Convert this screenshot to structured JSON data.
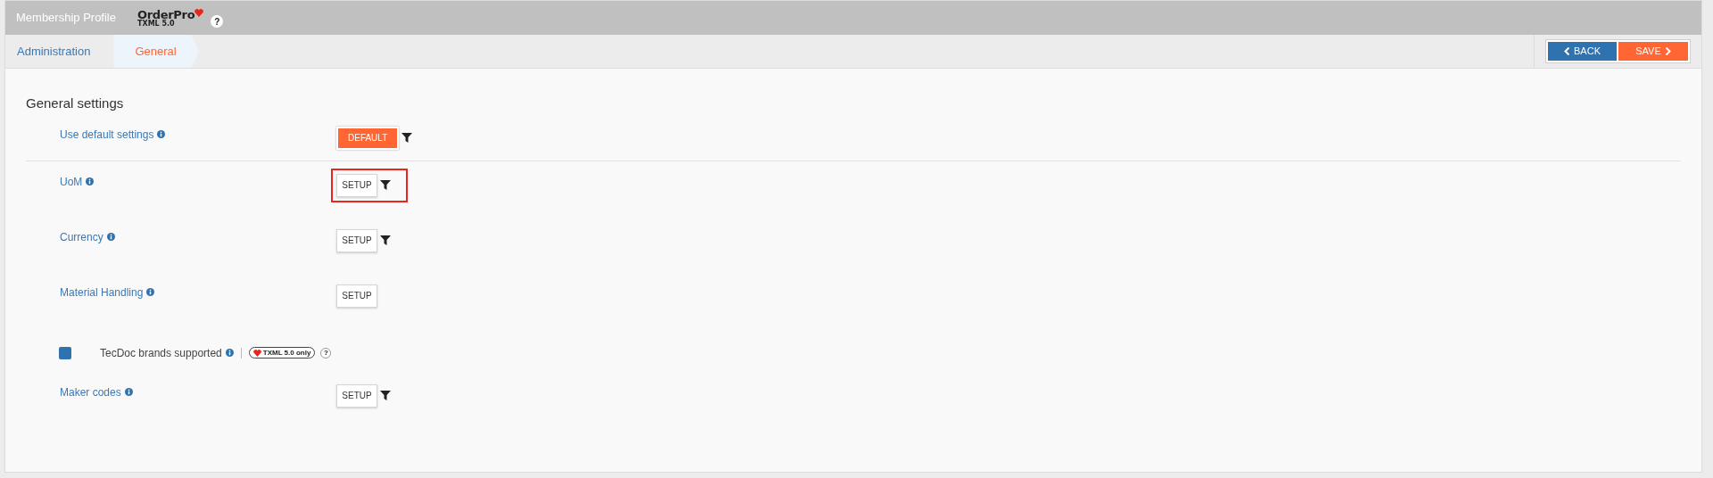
{
  "header": {
    "title": "Membership Profile",
    "logo_name": "OrderPro",
    "logo_version": "TXML 5.0",
    "help": "?"
  },
  "breadcrumb": [
    {
      "label": "Administration",
      "selected": false
    },
    {
      "label": "General",
      "selected": true
    }
  ],
  "actions": {
    "back": "BACK",
    "save": "SAVE"
  },
  "section_title": "General settings",
  "rows": [
    {
      "kind": "button",
      "label": "Use default settings",
      "button": "DEFAULT",
      "primary": true,
      "filter": true,
      "highlighted": false,
      "divider": true
    },
    {
      "kind": "button",
      "label": "UoM",
      "button": "SETUP",
      "primary": false,
      "filter": true,
      "highlighted": true,
      "divider": false
    },
    {
      "kind": "button",
      "label": "Currency",
      "button": "SETUP",
      "primary": false,
      "filter": true,
      "highlighted": false,
      "divider": false
    },
    {
      "kind": "button",
      "label": "Material Handling",
      "button": "SETUP",
      "primary": false,
      "filter": false,
      "highlighted": false,
      "divider": false
    },
    {
      "kind": "checkbox",
      "label": "TecDoc brands supported",
      "checked": true,
      "badge": "TXML 5.0 only",
      "help": "?"
    },
    {
      "kind": "button",
      "label": "Maker codes",
      "button": "SETUP",
      "primary": false,
      "filter": true,
      "highlighted": false,
      "divider": false
    }
  ]
}
